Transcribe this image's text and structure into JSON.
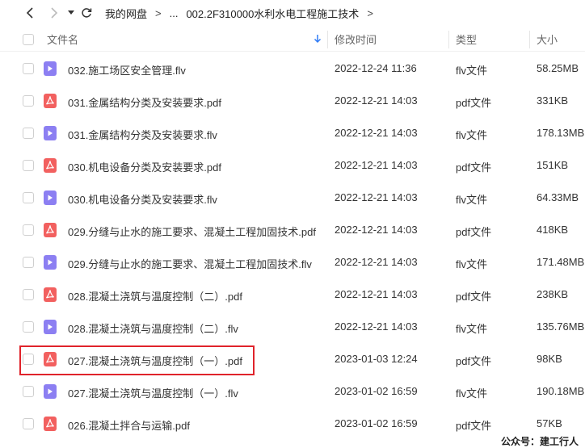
{
  "breadcrumb": {
    "items": [
      "我的网盘",
      "...",
      "002.2F310000水利水电工程施工技术"
    ],
    "separator": ">"
  },
  "columns": {
    "name": "文件名",
    "date": "修改时间",
    "type": "类型",
    "size": "大小"
  },
  "files": [
    {
      "kind": "video",
      "name": "032.施工场区安全管理.flv",
      "date": "2022-12-24 11:36",
      "type": "flv文件",
      "size": "58.25MB"
    },
    {
      "kind": "pdf",
      "name": "031.金属结构分类及安装要求.pdf",
      "date": "2022-12-21 14:03",
      "type": "pdf文件",
      "size": "331KB"
    },
    {
      "kind": "video",
      "name": "031.金属结构分类及安装要求.flv",
      "date": "2022-12-21 14:03",
      "type": "flv文件",
      "size": "178.13MB"
    },
    {
      "kind": "pdf",
      "name": "030.机电设备分类及安装要求.pdf",
      "date": "2022-12-21 14:03",
      "type": "pdf文件",
      "size": "151KB"
    },
    {
      "kind": "video",
      "name": "030.机电设备分类及安装要求.flv",
      "date": "2022-12-21 14:03",
      "type": "flv文件",
      "size": "64.33MB"
    },
    {
      "kind": "pdf",
      "name": "029.分缝与止水的施工要求、混凝土工程加固技术.pdf",
      "date": "2022-12-21 14:03",
      "type": "pdf文件",
      "size": "418KB"
    },
    {
      "kind": "video",
      "name": "029.分缝与止水的施工要求、混凝土工程加固技术.flv",
      "date": "2022-12-21 14:03",
      "type": "flv文件",
      "size": "171.48MB"
    },
    {
      "kind": "pdf",
      "name": "028.混凝土浇筑与温度控制（二）.pdf",
      "date": "2022-12-21 14:03",
      "type": "pdf文件",
      "size": "238KB"
    },
    {
      "kind": "video",
      "name": "028.混凝土浇筑与温度控制（二）.flv",
      "date": "2022-12-21 14:03",
      "type": "flv文件",
      "size": "135.76MB"
    },
    {
      "kind": "pdf",
      "name": "027.混凝土浇筑与温度控制（一）.pdf",
      "date": "2023-01-03 12:24",
      "type": "pdf文件",
      "size": "98KB"
    },
    {
      "kind": "video",
      "name": "027.混凝土浇筑与温度控制（一）.flv",
      "date": "2023-01-02 16:59",
      "type": "flv文件",
      "size": "190.18MB"
    },
    {
      "kind": "pdf",
      "name": "026.混凝土拌合与运输.pdf",
      "date": "2023-01-02 16:59",
      "type": "pdf文件",
      "size": "57KB"
    }
  ],
  "colors": {
    "video_icon": "#8c7ff2",
    "pdf_icon": "#f2605f",
    "highlight_border": "#e0232b",
    "sort_arrow": "#2f7bf5"
  },
  "watermark": "公众号：建工行人"
}
